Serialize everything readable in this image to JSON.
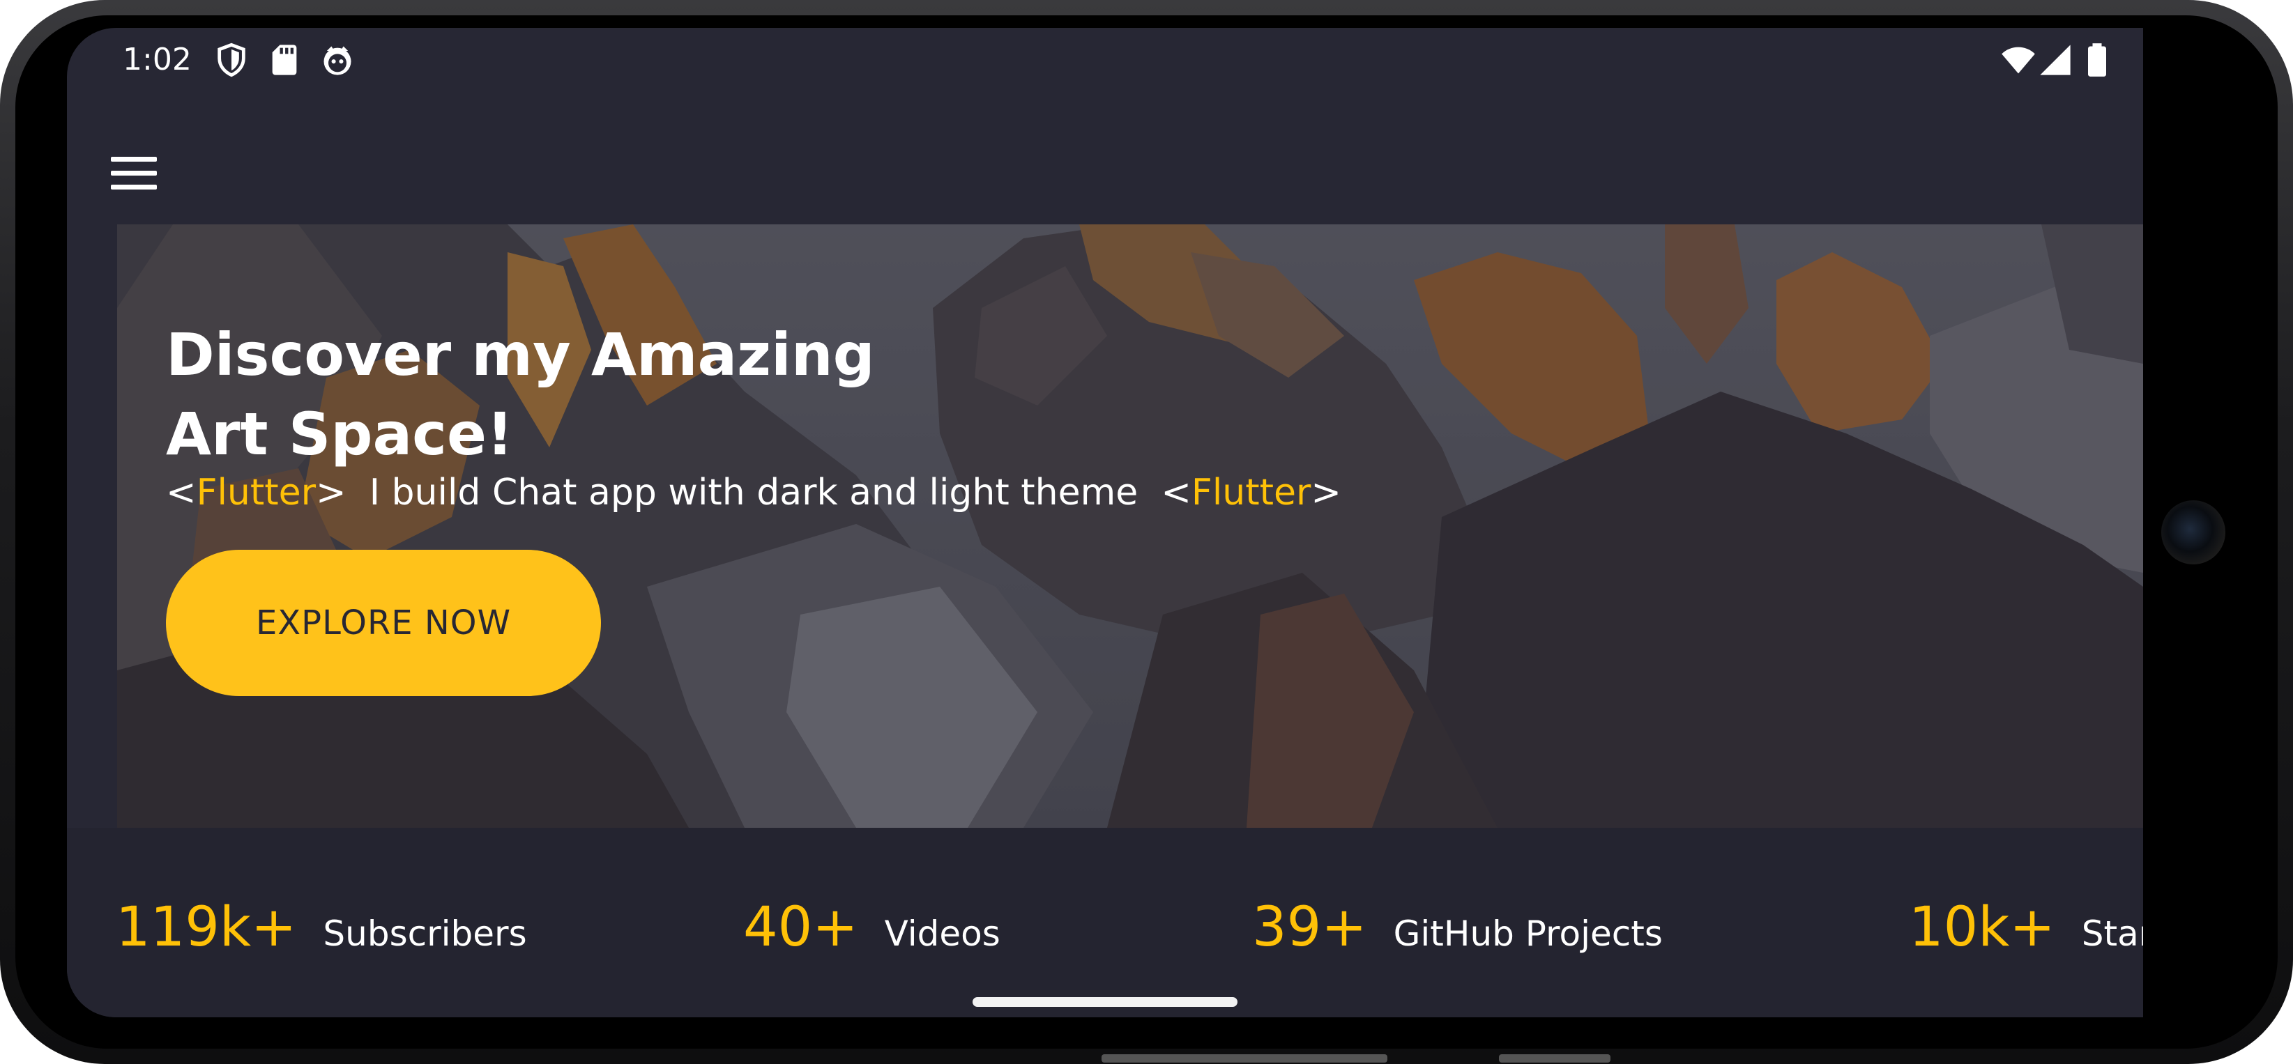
{
  "status_bar": {
    "time": "1:02",
    "left_icons": [
      "shield-icon",
      "sd-card-icon",
      "face-icon"
    ],
    "right_icons": [
      "wifi-icon",
      "signal-icon",
      "battery-icon"
    ]
  },
  "app_bar": {
    "menu_icon": "menu-icon"
  },
  "hero": {
    "title_line1": "Discover my Amazing",
    "title_line2": "Art Space!",
    "subtitle": {
      "open_bracket_left": "<",
      "tag_left": "Flutter",
      "close_bracket_left": ">",
      "text": "I build Chat app with dark and light theme",
      "open_bracket_right": "<",
      "tag_right": "Flutter",
      "close_bracket_right": ">"
    },
    "cta_label": "EXPLORE NOW"
  },
  "stats": [
    {
      "value": "119k+",
      "label": "Subscribers"
    },
    {
      "value": "40+",
      "label": "Videos"
    },
    {
      "value": "39+",
      "label": "GitHub Projects"
    },
    {
      "value": "10k+",
      "label": "Stars"
    }
  ],
  "colors": {
    "accent": "#FFC107",
    "background": "#272734",
    "stats_background": "#242430",
    "text": "#FFFFFF"
  }
}
